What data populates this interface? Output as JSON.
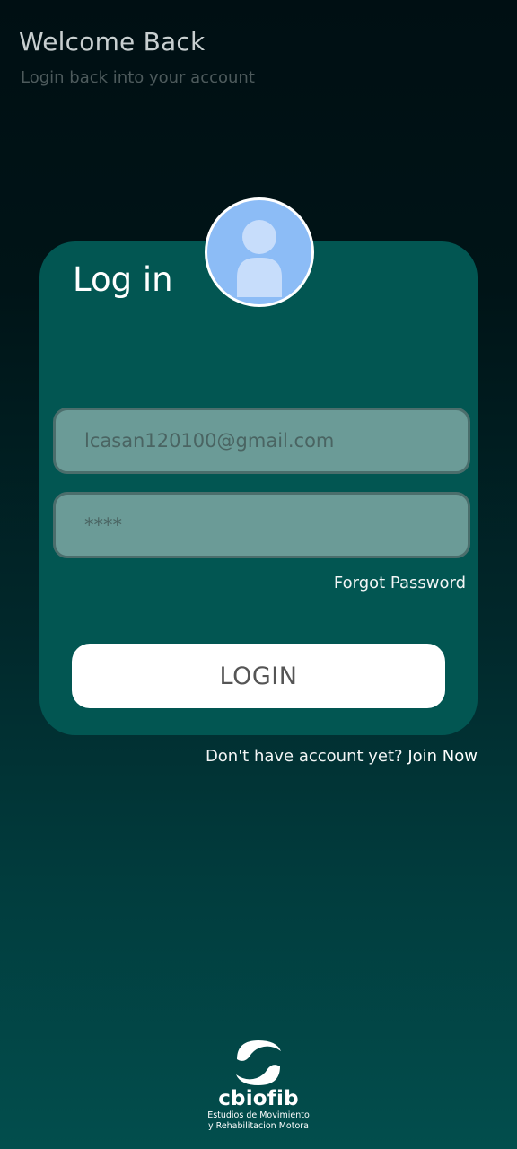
{
  "header": {
    "title": "Welcome Back",
    "subtitle": "Login back into your account"
  },
  "card": {
    "title": "Log in",
    "email_placeholder": "lcasan120100@gmail.com",
    "password_placeholder": "****",
    "forgot_password": "Forgot Password",
    "login_button": "LOGIN"
  },
  "signup": {
    "prompt": "Don't have account yet?",
    "link": "Join Now"
  },
  "logo": {
    "name": "cbiofib",
    "tagline_1": "Estudios de Movimiento",
    "tagline_2": "y Rehabilitacion Motora"
  },
  "icons": {
    "avatar": "user-avatar-icon",
    "logo_mark": "wave-logo-icon"
  },
  "colors": {
    "background_top": "#000f13",
    "background_bottom": "#024e4d",
    "card": "#025652",
    "field": "#6b9b97",
    "avatar": "#8cbcf6",
    "button": "#ffffff"
  }
}
